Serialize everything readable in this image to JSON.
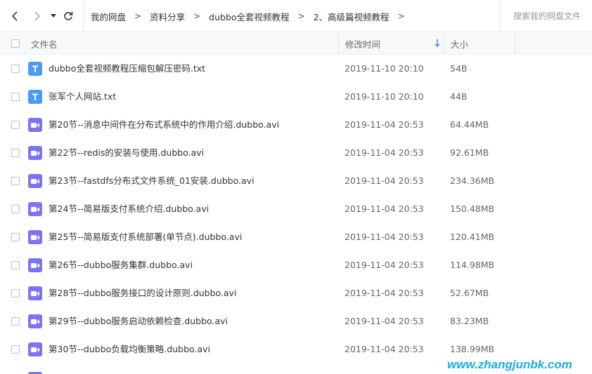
{
  "breadcrumb": {
    "items": [
      "我的网盘",
      "资料分享",
      "dubbo全套视频教程",
      "2、高级篇视频教程"
    ],
    "separator": ">"
  },
  "search": {
    "placeholder": "搜索我的网盘文件"
  },
  "table": {
    "headers": {
      "name": "文件名",
      "modified": "修改时间",
      "size": "大小"
    },
    "sort_indicator": "arrow-down-icon",
    "rows": [
      {
        "type": "txt",
        "name": "dubbo全套视频教程压缩包解压密码.txt",
        "date": "2019-11-10 20:10",
        "size": "54B"
      },
      {
        "type": "txt",
        "name": "张军个人网站.txt",
        "date": "2019-11-10 20:10",
        "size": "44B"
      },
      {
        "type": "video",
        "name": "第20节--消息中间件在分布式系统中的作用介绍.dubbo.avi",
        "date": "2019-11-04 20:53",
        "size": "64.44MB"
      },
      {
        "type": "video",
        "name": "第22节--redis的安装与使用.dubbo.avi",
        "date": "2019-11-04 20:53",
        "size": "92.61MB"
      },
      {
        "type": "video",
        "name": "第23节--fastdfs分布式文件系统_01安装.dubbo.avi",
        "date": "2019-11-04 20:53",
        "size": "234.36MB"
      },
      {
        "type": "video",
        "name": "第24节--简易版支付系统介绍.dubbo.avi",
        "date": "2019-11-04 20:53",
        "size": "150.48MB"
      },
      {
        "type": "video",
        "name": "第25节--简易版支付系统部署(单节点).dubbo.avi",
        "date": "2019-11-04 20:53",
        "size": "120.41MB"
      },
      {
        "type": "video",
        "name": "第26节--dubbo服务集群.dubbo.avi",
        "date": "2019-11-04 20:53",
        "size": "114.98MB"
      },
      {
        "type": "video",
        "name": "第28节--dubbo服务接口的设计原则.dubbo.avi",
        "date": "2019-11-04 20:53",
        "size": "52.67MB"
      },
      {
        "type": "video",
        "name": "第29节--dubbo服务启动依赖检查.dubbo.avi",
        "date": "2019-11-04 20:53",
        "size": "83.23MB"
      },
      {
        "type": "video",
        "name": "第30节--dubbo负载均衡策略.dubbo.avi",
        "date": "2019-11-04 20:53",
        "size": "138.99MB"
      }
    ]
  },
  "watermark": "www.zhangjunbk.com",
  "colors": {
    "txt_icon": "#4a9bf5",
    "video_icon": "#7b74f0",
    "sort_arrow": "#3a8ef0",
    "watermark": "#19aee8"
  }
}
